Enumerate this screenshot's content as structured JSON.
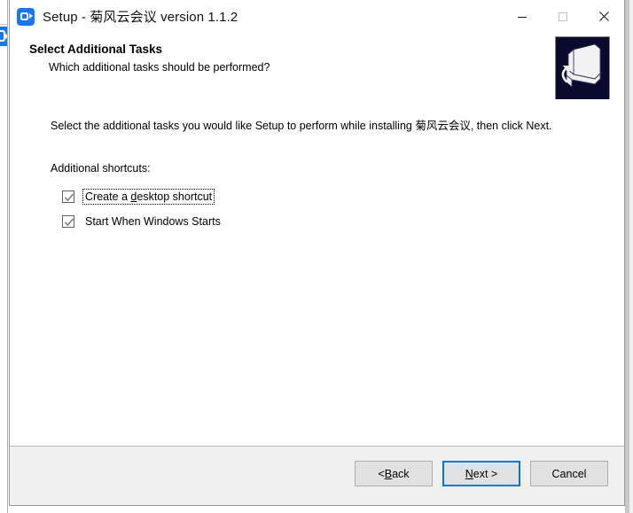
{
  "window": {
    "title": "Setup - 菊风云会议 version 1.1.2",
    "app_icon": "video-camera-icon",
    "controls": {
      "minimize": "minimize-icon",
      "maximize": "maximize-icon",
      "close": "close-icon"
    }
  },
  "header": {
    "title": "Select Additional Tasks",
    "subtitle": "Which additional tasks should be performed?",
    "logo": "setup-computer-logo"
  },
  "body": {
    "intro": "Select the additional tasks you would like Setup to perform while installing 菊风云会议, then click Next.",
    "group_label": "Additional shortcuts:",
    "tasks": [
      {
        "label_before": "Create a ",
        "accel": "d",
        "label_after": "esktop shortcut",
        "checked": true,
        "focused": true
      },
      {
        "label_before": "Start When Windows Starts",
        "accel": "",
        "label_after": "",
        "checked": true,
        "focused": false
      }
    ]
  },
  "footer": {
    "buttons": [
      {
        "before": "< ",
        "accel": "B",
        "after": "ack",
        "default": false
      },
      {
        "before": "",
        "accel": "N",
        "after": "ext >",
        "default": true
      },
      {
        "before": "Cancel",
        "accel": "",
        "after": "",
        "default": false
      }
    ]
  },
  "colors": {
    "accent": "#0078d7",
    "brand_blue": "#1877f2",
    "logo_navy": "#0a0a2e",
    "footer_bg": "#f0f0f0"
  }
}
